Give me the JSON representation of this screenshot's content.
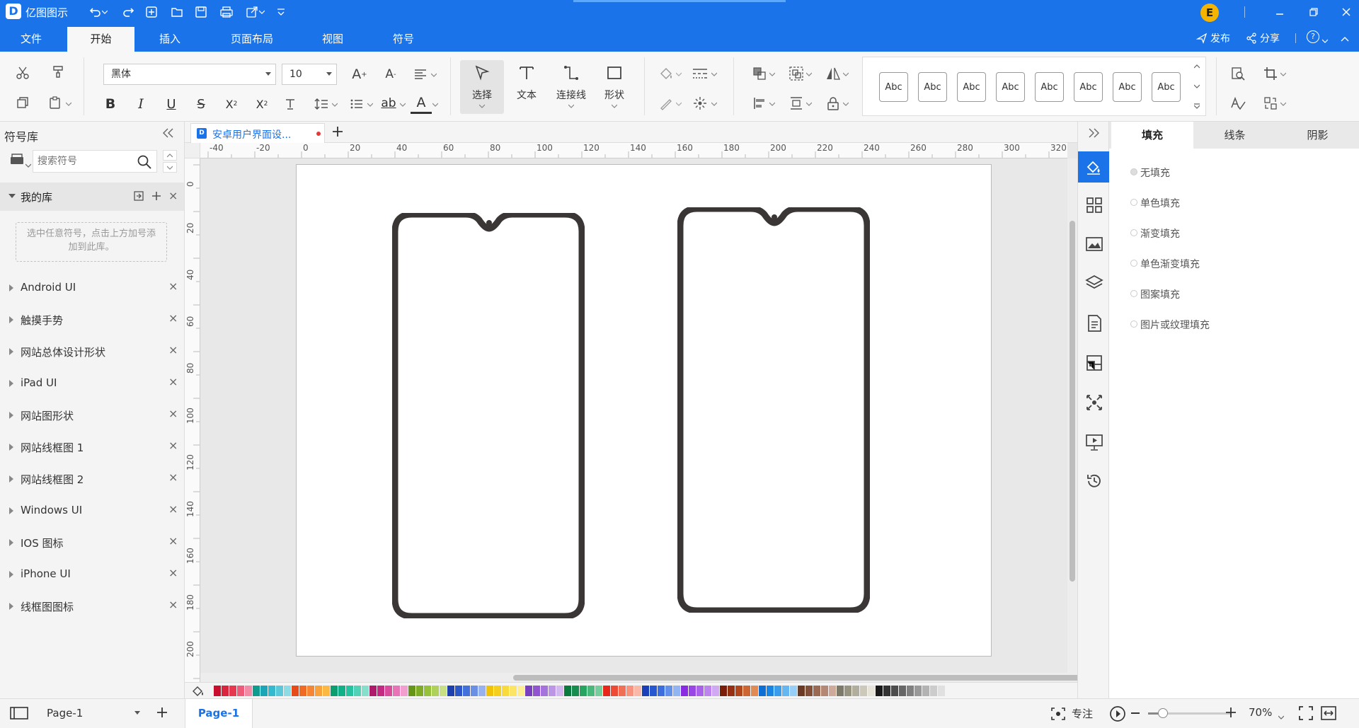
{
  "app": {
    "title": "亿图图示"
  },
  "menu": {
    "tabs": [
      "文件",
      "开始",
      "插入",
      "页面布局",
      "视图",
      "符号"
    ],
    "active": 1
  },
  "header_right": {
    "user_initial": "E",
    "publish": "发布",
    "share": "分享"
  },
  "ribbon": {
    "font_name": "黑体",
    "font_size": "10",
    "tools": {
      "select": "选择",
      "text": "文本",
      "connector": "连接线",
      "shape": "形状"
    },
    "style_samples": [
      "Abc",
      "Abc",
      "Abc",
      "Abc",
      "Abc",
      "Abc",
      "Abc",
      "Abc"
    ]
  },
  "library": {
    "title": "符号库",
    "search_placeholder": "搜索符号",
    "my_library": "我的库",
    "hint": "选中任意符号，点击上方加号添加到此库。",
    "items": [
      "Android UI",
      "触摸手势",
      "网站总体设计形状",
      "iPad UI",
      "网站图形状",
      "网站线框图 1",
      "网站线框图 2",
      "Windows UI",
      "IOS 图标",
      "iPhone UI",
      "线框图图标"
    ]
  },
  "document": {
    "tab_title": "安卓用户界面设..."
  },
  "ruler": {
    "h_ticks": [
      "-40",
      "-20",
      "0",
      "20",
      "40",
      "60",
      "80",
      "100",
      "120",
      "140",
      "160",
      "180",
      "200",
      "220",
      "240",
      "260",
      "280",
      "300",
      "320"
    ],
    "v_ticks": [
      "0",
      "20",
      "40",
      "60",
      "80",
      "100",
      "120",
      "140",
      "160",
      "180",
      "200"
    ]
  },
  "right_panel": {
    "tabs": [
      "填充",
      "线条",
      "阴影"
    ],
    "active_tab": 0,
    "fill_options": [
      "无填充",
      "单色填充",
      "渐变填充",
      "单色渐变填充",
      "图案填充",
      "图片或纹理填充"
    ],
    "selected_option": 0
  },
  "statusbar": {
    "page_select": "Page-1",
    "page_tab": "Page-1",
    "focus": "专注",
    "zoom": "70%"
  },
  "palette": [
    "#c8102e",
    "#d7263d",
    "#e63950",
    "#ef5b7b",
    "#f28ba6",
    "#0f9b8e",
    "#1aa6b7",
    "#36b9cc",
    "#5ac8d8",
    "#8ddbe5",
    "#e84b1a",
    "#f06a24",
    "#f58634",
    "#f9a13a",
    "#fbb941",
    "#0c9e6e",
    "#12b088",
    "#27c2a0",
    "#52d1b6",
    "#84dfcb",
    "#b01a6b",
    "#c52a82",
    "#d94b9b",
    "#e774b6",
    "#f29fcf",
    "#66951a",
    "#7eac27",
    "#96c13a",
    "#aed15a",
    "#c6e083",
    "#1e3fae",
    "#2b57c8",
    "#4470dc",
    "#6c8fe6",
    "#98b2ef",
    "#f0c20a",
    "#f5cf1d",
    "#f8da3d",
    "#fbe466",
    "#fdee96",
    "#7a3fc0",
    "#9055cf",
    "#a672dc",
    "#bd95e6",
    "#d3b8f0",
    "#0b7a3e",
    "#168d4c",
    "#27a45f",
    "#48b97b",
    "#75cd9c",
    "#e8261a",
    "#ee4a36",
    "#f36e57",
    "#f7937e",
    "#fab8a8",
    "#1a3fb8",
    "#2855d0",
    "#3d6ee0",
    "#6390ea",
    "#92b4f2",
    "#8a2be2",
    "#9a45e6",
    "#ab62ea",
    "#bd84ef",
    "#d0a8f4",
    "#7a1e0b",
    "#963013",
    "#b2471e",
    "#cc6632",
    "#e08a55",
    "#0d6fd6",
    "#1a85e3",
    "#3a9dec",
    "#66b6f2",
    "#97cef7",
    "#6b3a24",
    "#82503a",
    "#9b6a55",
    "#b58875",
    "#cfaa9b",
    "#7e7a6a",
    "#989482",
    "#b2ae9e",
    "#ccc8ba",
    "#e6e3d8",
    "#1a1a1a",
    "#333333",
    "#4d4d4d",
    "#666666",
    "#808080",
    "#999999",
    "#b3b3b3",
    "#cccccc",
    "#e0e0e0"
  ]
}
